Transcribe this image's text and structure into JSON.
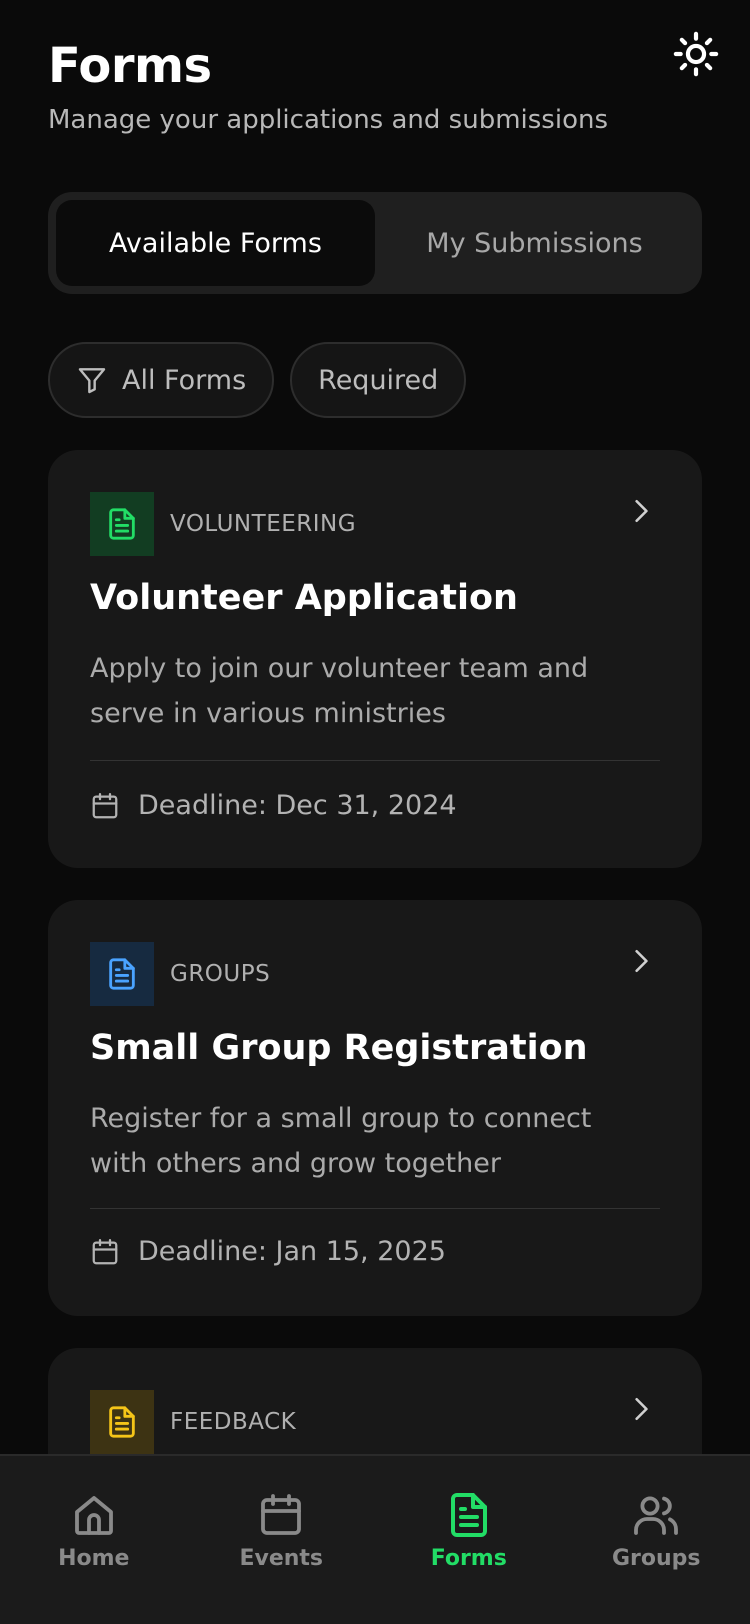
{
  "header": {
    "title": "Forms",
    "subtitle": "Manage your applications and submissions",
    "theme_icon": "sun-icon"
  },
  "tabs": [
    {
      "label": "Available Forms",
      "active": true
    },
    {
      "label": "My Submissions",
      "active": false
    }
  ],
  "filters": [
    {
      "label": "All Forms",
      "icon": "filter-icon"
    },
    {
      "label": "Required"
    }
  ],
  "forms": [
    {
      "category": "VOLUNTEERING",
      "title": "Volunteer Application",
      "description": "Apply to join our volunteer team and serve in various ministries",
      "deadline": "Deadline: Dec 31, 2024",
      "accent": "#22dd66",
      "accent_bg": "#123d22"
    },
    {
      "category": "GROUPS",
      "title": "Small Group Registration",
      "description": "Register for a small group to connect with others and grow together",
      "deadline": "Deadline: Jan 15, 2025",
      "accent": "#4aa3ff",
      "accent_bg": "#162a40"
    },
    {
      "category": "FEEDBACK",
      "accent": "#f5c518",
      "accent_bg": "#3d3313"
    }
  ],
  "nav": [
    {
      "label": "Home",
      "icon": "home-icon",
      "active": false
    },
    {
      "label": "Events",
      "icon": "calendar-icon",
      "active": false
    },
    {
      "label": "Forms",
      "icon": "document-icon",
      "active": true
    },
    {
      "label": "Groups",
      "icon": "users-icon",
      "active": false
    }
  ],
  "colors": {
    "background": "#0a0a0a",
    "card": "#181818",
    "active_nav": "#22dd66"
  }
}
